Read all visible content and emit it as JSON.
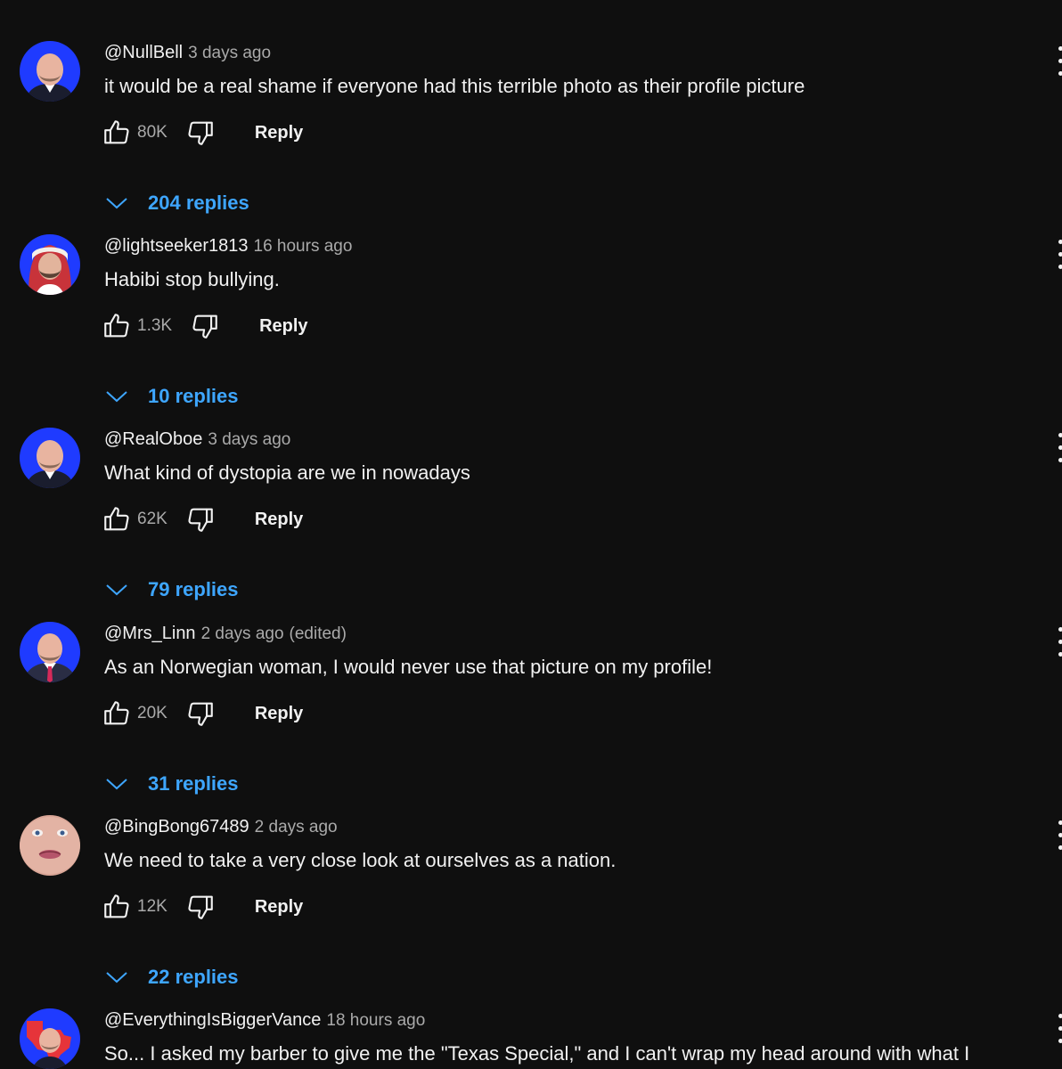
{
  "comments": [
    {
      "author": "@NullBell",
      "time": "3 days ago",
      "edited": "",
      "text": "it would be a real shame if everyone had this terrible photo as their profile picture",
      "likes": "80K",
      "reply_label": "Reply",
      "replies": "204 replies",
      "avatar": "bald-man-blue-bg"
    },
    {
      "author": "@lightseeker1813",
      "time": "16 hours ago",
      "edited": "",
      "text": "Habibi stop bullying.",
      "likes": "1.3K",
      "reply_label": "Reply",
      "replies": "10 replies",
      "avatar": "man-red-keffiyeh"
    },
    {
      "author": "@RealOboe",
      "time": "3 days ago",
      "edited": "",
      "text": "What kind of dystopia are we in nowadays",
      "likes": "62K",
      "reply_label": "Reply",
      "replies": "79 replies",
      "avatar": "bald-man-blue-bg"
    },
    {
      "author": "@Mrs_Linn",
      "time": "2 days ago",
      "edited": "(edited)",
      "text": "As an Norwegian woman, I would never use that picture on my profile!",
      "likes": "20K",
      "reply_label": "Reply",
      "replies": "31 replies",
      "avatar": "bald-man-suit"
    },
    {
      "author": "@BingBong67489",
      "time": "2 days ago",
      "edited": "",
      "text": "We need to take a very close look at ourselves as a nation.",
      "likes": "12K",
      "reply_label": "Reply",
      "replies": "22 replies",
      "avatar": "face-closeup"
    },
    {
      "author": "@EverythingIsBiggerVance",
      "time": "18 hours ago",
      "edited": "",
      "text": "So... I asked my barber to give me the \"Texas Special,\" and I can't wrap my head around with what I",
      "likes": "",
      "reply_label": "",
      "replies": "",
      "avatar": "man-texas-map"
    }
  ],
  "colors": {
    "background": "#0f0f0f",
    "primary_text": "#f1f1f1",
    "secondary_text": "#aaaaaa",
    "link_blue": "#3ea6ff",
    "avatar_blue": "#1f3bff"
  },
  "icons": {
    "like": "thumbs-up-icon",
    "dislike": "thumbs-down-icon",
    "expand": "chevron-down-icon",
    "more": "more-vert-icon"
  }
}
